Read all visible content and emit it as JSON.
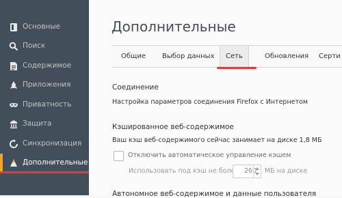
{
  "sidebar": {
    "items": [
      {
        "label": "Основные",
        "icon": "general-icon"
      },
      {
        "label": "Поиск",
        "icon": "search-icon"
      },
      {
        "label": "Содержимое",
        "icon": "content-icon"
      },
      {
        "label": "Приложения",
        "icon": "applications-icon"
      },
      {
        "label": "Приватность",
        "icon": "privacy-mask-icon"
      },
      {
        "label": "Защита",
        "icon": "security-icon"
      },
      {
        "label": "Синхронизация",
        "icon": "sync-icon"
      },
      {
        "label": "Дополнительные",
        "icon": "advanced-icon",
        "active": true
      }
    ]
  },
  "main": {
    "title": "Дополнительные",
    "tabs": [
      {
        "label": "Общие"
      },
      {
        "label": "Выбор данных"
      },
      {
        "label": "Сеть",
        "active": true
      },
      {
        "label": "Обновления"
      },
      {
        "label": "Серти"
      }
    ],
    "connection": {
      "title": "Соединение",
      "description": "Настройка параметров соединения Firefox с Интернетом"
    },
    "cache": {
      "title": "Кэшированное веб-содержимое",
      "description": "Ваш кэш веб-содержимого сейчас занимает на диске 1,8 МБ",
      "override_label": "Отключить автоматическое управление кэшем",
      "limit_label": "Использовать под кэш не более",
      "limit_value": "260",
      "limit_unit": "МБ на диске"
    },
    "next_section_title": "Автономное веб-содержимое и данные пользователя"
  },
  "colors": {
    "sidebar_bg": "#424f5a",
    "active_accent": "#f5a62a",
    "annotation_red": "#e53a3a"
  }
}
